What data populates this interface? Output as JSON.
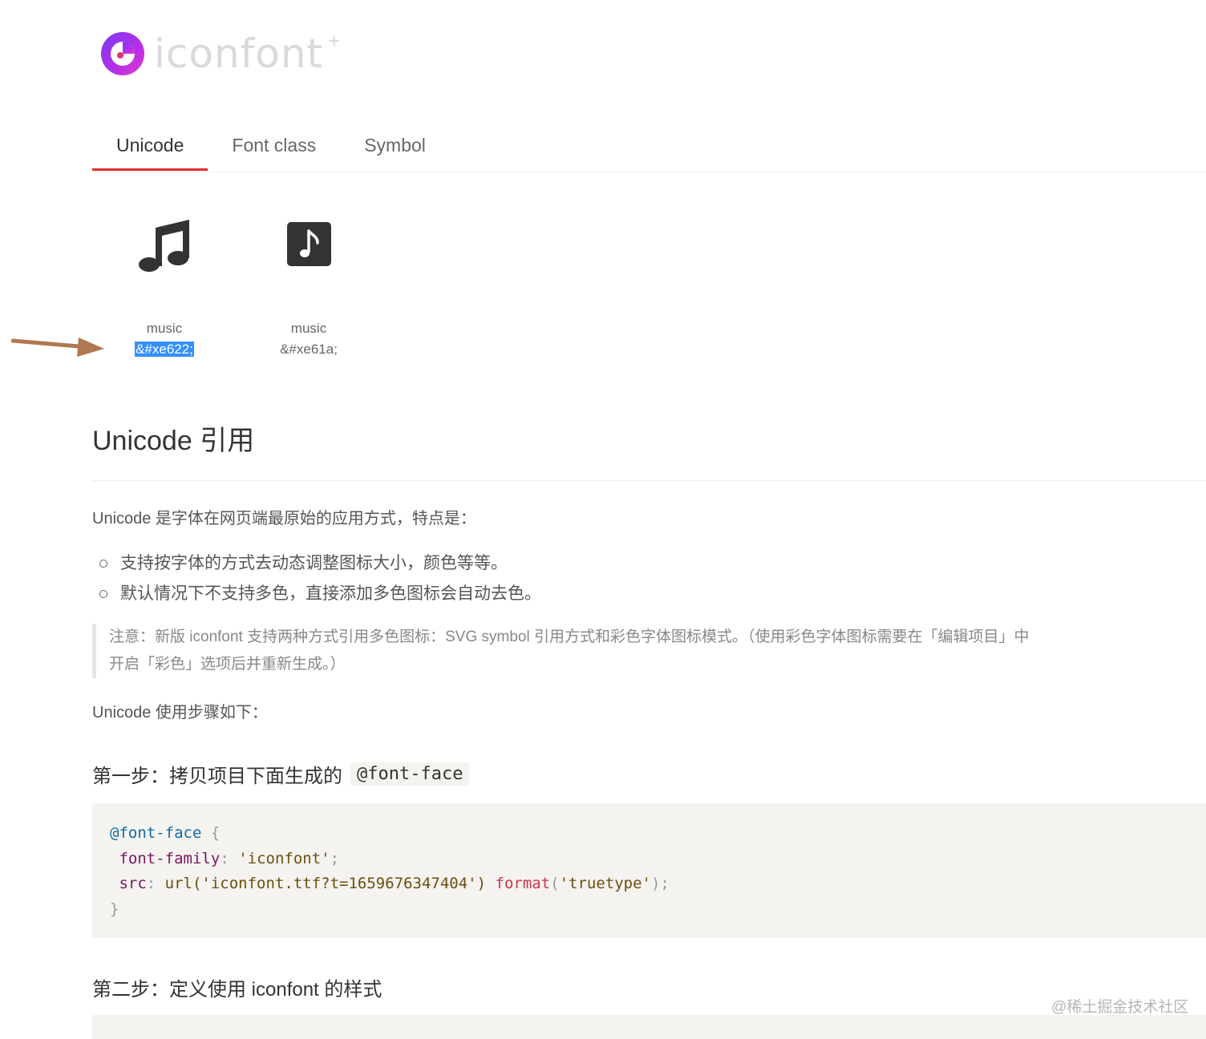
{
  "logo": {
    "text": "iconfont",
    "plus": "+"
  },
  "tabs": [
    {
      "label": "Unicode",
      "active": true
    },
    {
      "label": "Font class",
      "active": false
    },
    {
      "label": "Symbol",
      "active": false
    }
  ],
  "icons": [
    {
      "icon": "music-notes-icon",
      "name": "music",
      "code": "&#xe622;",
      "selected": true
    },
    {
      "icon": "music-square-icon",
      "name": "music",
      "code": "&#xe61a;",
      "selected": false
    }
  ],
  "section": {
    "title": "Unicode 引用",
    "intro": "Unicode 是字体在网页端最原始的应用方式，特点是：",
    "bullets": [
      "支持按字体的方式去动态调整图标大小，颜色等等。",
      "默认情况下不支持多色，直接添加多色图标会自动去色。"
    ],
    "note_line1": "注意：新版 iconfont 支持两种方式引用多色图标：SVG symbol 引用方式和彩色字体图标模式。（使用彩色字体图标需要在「编辑项目」中",
    "note_line2": "开启「彩色」选项后并重新生成。）",
    "steps_intro": "Unicode 使用步骤如下：",
    "step1_title": "第一步：拷贝项目下面生成的",
    "step1_code": "@font-face",
    "code": {
      "line1_at": "@font-face",
      "line1_brace": " {",
      "line2_prop": "font-family",
      "line2_colon": ": ",
      "line2_val": "'iconfont'",
      "line2_end": ";",
      "line3_prop": "src",
      "line3_colon": ": ",
      "line3_url": "url('iconfont.ttf?t=1659676347404')",
      "line3_fn": "format",
      "line3_paren_open": "(",
      "line3_val": "'truetype'",
      "line3_end": ");",
      "line4": "}"
    },
    "step2_title": "第二步：定义使用 iconfont 的样式"
  },
  "watermark": "@稀土掘金技术社区",
  "colors": {
    "accent": "#e02d2d",
    "selection": "#3390ff",
    "arrow": "#b07850"
  }
}
